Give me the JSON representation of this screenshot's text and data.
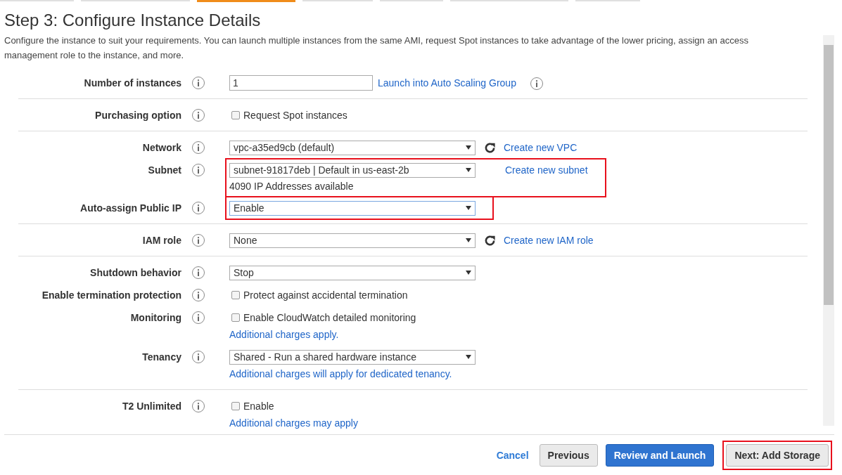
{
  "wizard_tabs": [
    {
      "selected": false
    },
    {
      "selected": false
    },
    {
      "selected": true
    },
    {
      "selected": false
    },
    {
      "selected": false
    },
    {
      "selected": false
    },
    {
      "selected": false
    }
  ],
  "title": "Step 3: Configure Instance Details",
  "description": "Configure the instance to suit your requirements. You can launch multiple instances from the same AMI, request Spot instances to take advantage of the lower pricing, assign an access management role to the instance, and more.",
  "sections": [
    {
      "rows": [
        {
          "label": "Number of instances",
          "kind": "text",
          "value": "1",
          "link": "Launch into Auto Scaling Group",
          "link_info": true
        }
      ]
    },
    {
      "rows": [
        {
          "label": "Purchasing option",
          "kind": "checkbox",
          "checked": false,
          "text": "Request Spot instances"
        }
      ]
    },
    {
      "rows": [
        {
          "label": "Network",
          "kind": "select",
          "value": "vpc-a35ed9cb (default)",
          "refresh": true,
          "link": "Create new VPC",
          "highlighted": false
        },
        {
          "label": "Subnet",
          "kind": "select",
          "value": "subnet-91817deb | Default in us-east-2b",
          "refresh": false,
          "link": "Create new subnet",
          "highlighted": true,
          "notes": [
            {
              "kind": "text",
              "text": "4090 IP Addresses available"
            }
          ]
        },
        {
          "label": "Auto-assign Public IP",
          "kind": "select",
          "value": "Enable",
          "refresh": false,
          "highlighted": true,
          "focused": true
        }
      ]
    },
    {
      "rows": [
        {
          "label": "IAM role",
          "kind": "select",
          "value": "None",
          "refresh": true,
          "link": "Create new IAM role",
          "highlighted": false
        }
      ]
    },
    {
      "rows": [
        {
          "label": "Shutdown behavior",
          "kind": "select",
          "value": "Stop",
          "refresh": false,
          "highlighted": false
        },
        {
          "label": "Enable termination protection",
          "kind": "checkbox",
          "checked": false,
          "text": "Protect against accidental termination"
        },
        {
          "label": "Monitoring",
          "kind": "checkbox",
          "checked": false,
          "text": "Enable CloudWatch detailed monitoring",
          "notes": [
            {
              "kind": "link",
              "text": "Additional charges apply."
            }
          ]
        },
        {
          "label": "Tenancy",
          "kind": "select",
          "value": "Shared - Run a shared hardware instance",
          "refresh": false,
          "highlighted": false,
          "notes": [
            {
              "kind": "link",
              "text": "Additional charges will apply for dedicated tenancy."
            }
          ]
        }
      ]
    },
    {
      "rows": [
        {
          "label": "T2 Unlimited",
          "kind": "checkbox",
          "checked": false,
          "text": "Enable",
          "notes": [
            {
              "kind": "link",
              "text": "Additional charges may apply"
            }
          ]
        }
      ]
    }
  ],
  "footer": {
    "cancel": "Cancel",
    "buttons": [
      {
        "label": "Previous",
        "kind": "secondary",
        "highlighted": false
      },
      {
        "label": "Review and Launch",
        "kind": "primary",
        "highlighted": false
      },
      {
        "label": "Next: Add Storage",
        "kind": "secondary",
        "highlighted": true
      }
    ]
  }
}
